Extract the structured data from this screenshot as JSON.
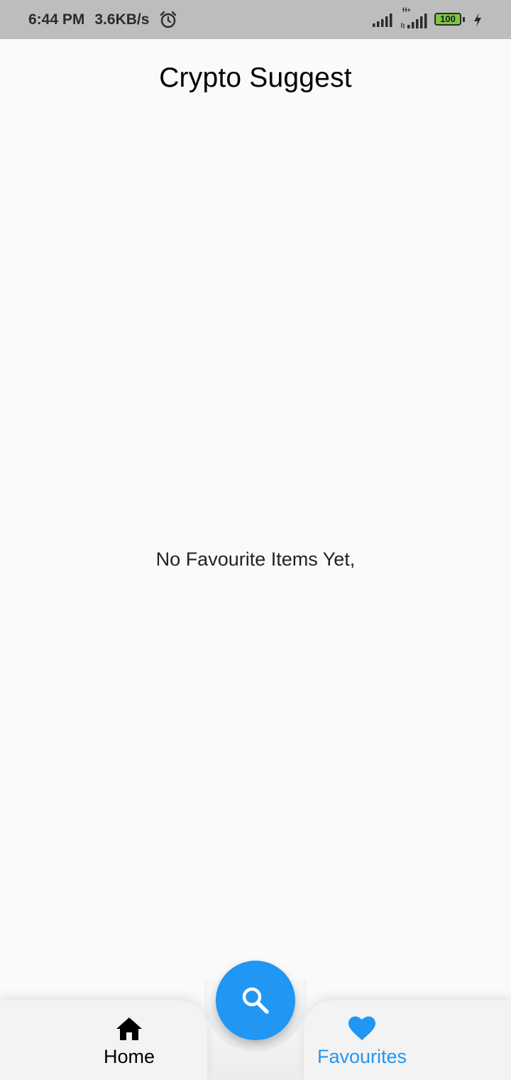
{
  "status_bar": {
    "time": "6:44 PM",
    "network_speed": "3.6KB/s",
    "alarm_icon": "alarm-clock-icon",
    "signal_icons": [
      "signal-icon",
      "signal-h-plus-icon"
    ],
    "network_type": "H+",
    "battery_level": "100",
    "charging_icon": "bolt-icon"
  },
  "header": {
    "title": "Crypto Suggest"
  },
  "main": {
    "empty_message": "No Favourite Items Yet,"
  },
  "bottom_nav": {
    "fab_icon": "search-icon",
    "items": [
      {
        "label": "Home",
        "icon": "home-icon",
        "active": false
      },
      {
        "label": "Favourites",
        "icon": "heart-icon",
        "active": true
      }
    ]
  },
  "colors": {
    "accent": "#2196f3",
    "status_bar_bg": "#bdbdbd",
    "page_bg": "#fafafa",
    "battery_fill": "#7bc842"
  }
}
